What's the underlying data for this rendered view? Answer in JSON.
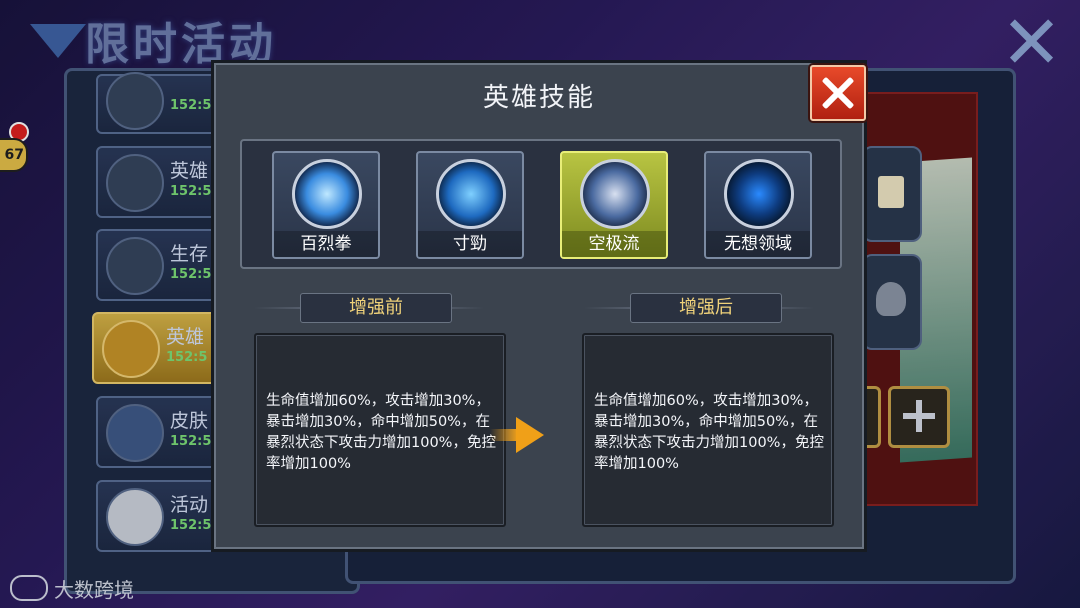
{
  "background": {
    "title": "限时活动",
    "events": [
      {
        "name": "",
        "time": "152:5"
      },
      {
        "name": "英雄",
        "time": "152:5"
      },
      {
        "name": "生存",
        "time": "152:5"
      },
      {
        "name": "英雄",
        "time": "152:5"
      },
      {
        "name": "皮肤",
        "time": "152:5"
      },
      {
        "name": "活动",
        "time": "152:5"
      }
    ],
    "badge_number": "67"
  },
  "modal": {
    "title": "英雄技能",
    "skills": [
      {
        "label": "百烈拳",
        "selected": false,
        "icon": "fist-burst-icon",
        "color": "#4aa8ff"
      },
      {
        "label": "寸勁",
        "selected": false,
        "icon": "water-strike-icon",
        "color": "#2f8fe0"
      },
      {
        "label": "空极流",
        "selected": true,
        "icon": "hero-portrait-icon",
        "color": "#6fa0d8"
      },
      {
        "label": "无想领域",
        "selected": false,
        "icon": "silhouette-aura-icon",
        "color": "#3ab0ff"
      }
    ],
    "before": {
      "heading": "增强前",
      "text": "生命值增加60%，攻击增加30%，暴击增加30%，命中增加50%，在暴烈状态下攻击力增加100%，免控率增加100%"
    },
    "after": {
      "heading": "增强后",
      "text": "生命值增加60%，攻击增加30%，暴击增加30%，命中增加50%，在暴烈状态下攻击力增加100%，免控率增加100%"
    }
  },
  "watermark": "大数跨境"
}
